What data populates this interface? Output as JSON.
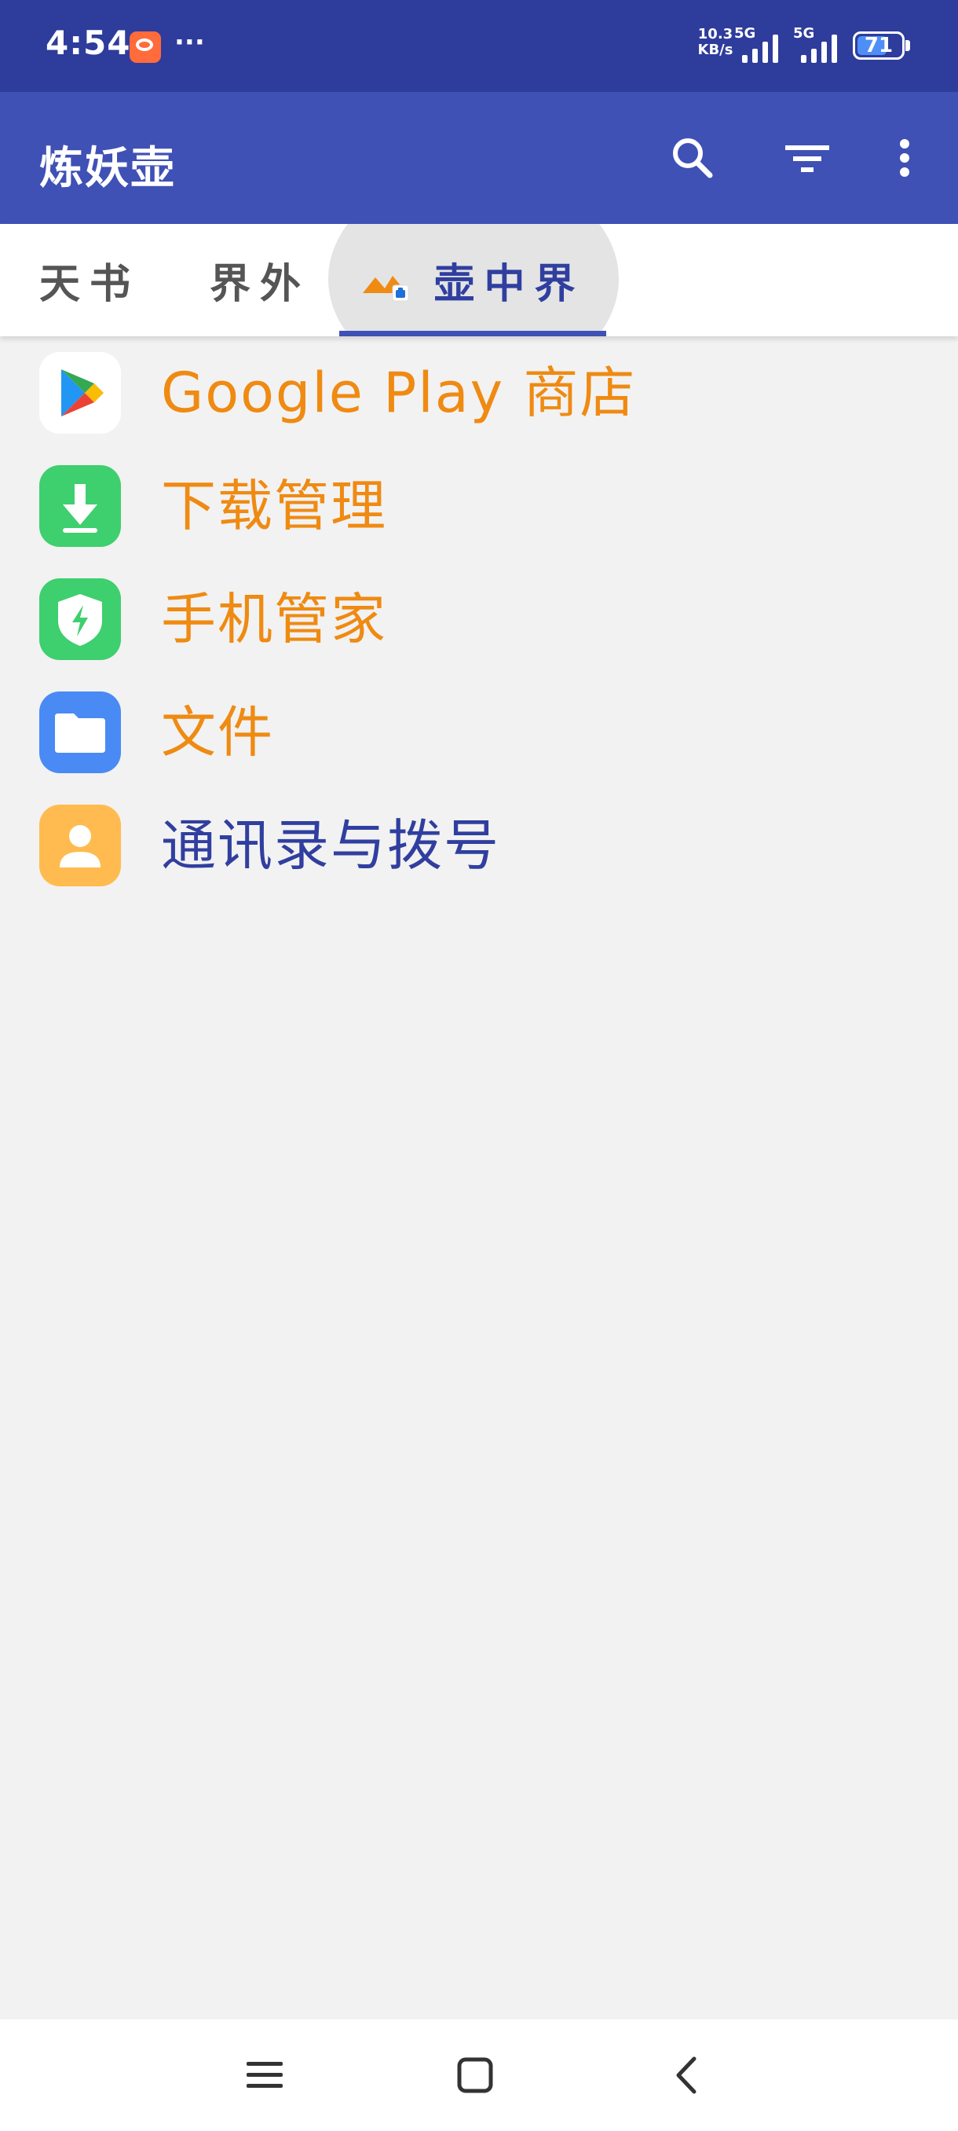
{
  "status_bar": {
    "time": "4:54",
    "dots": "···",
    "speed_value": "10.3",
    "speed_unit": "KB/s",
    "sim1_label": "5G",
    "sim2_label": "5G",
    "battery": "71",
    "battery_level": 0.71
  },
  "app_bar": {
    "title": "炼妖壶"
  },
  "tabs": [
    {
      "label": "天书"
    },
    {
      "label": "界外"
    },
    {
      "label": "壶中界"
    }
  ],
  "apps": [
    {
      "label": "Google Play 商店",
      "color": "#ef8a12",
      "icon": "google-play-icon"
    },
    {
      "label": "下载管理",
      "color": "#ef8a12",
      "icon": "download-icon"
    },
    {
      "label": "手机管家",
      "color": "#ef8a12",
      "icon": "shield-icon"
    },
    {
      "label": "文件",
      "color": "#ef8a12",
      "icon": "folder-icon"
    },
    {
      "label": "通讯录与拨号",
      "color": "#303f9f",
      "icon": "contact-icon"
    }
  ],
  "colors": {
    "status_bar": "#2e3c9c",
    "app_bar": "#3f51b5",
    "accent_orange": "#ef8a12",
    "accent_indigo": "#303f9f",
    "background": "#f2f2f2"
  }
}
